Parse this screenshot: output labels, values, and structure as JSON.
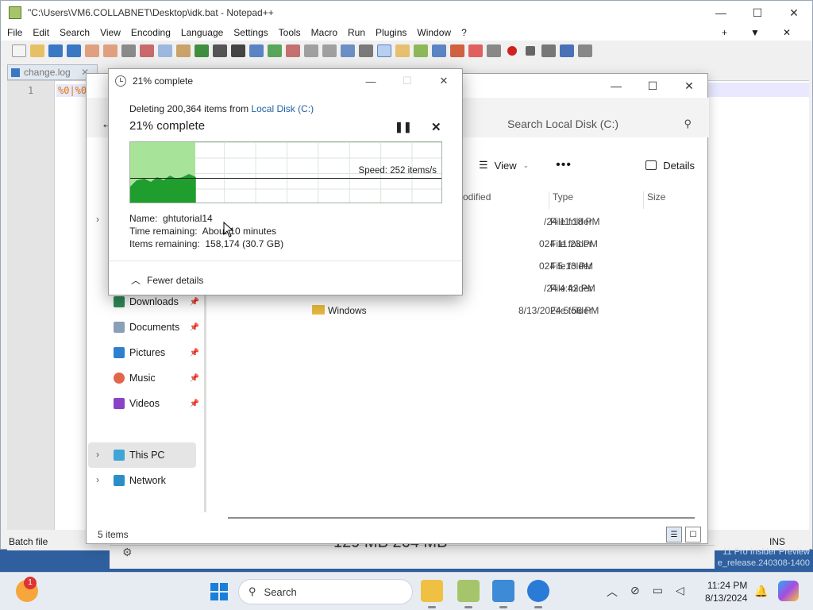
{
  "notepad": {
    "title": "\"C:\\Users\\VM6.COLLABNET\\Desktop\\idk.bat - Notepad++",
    "menu": [
      "File",
      "Edit",
      "Search",
      "View",
      "Encoding",
      "Language",
      "Settings",
      "Tools",
      "Macro",
      "Run",
      "Plugins",
      "Window",
      "?"
    ],
    "menu_right": [
      "+",
      "▼",
      "✕"
    ],
    "tab_label": "change.log",
    "line_number": "1",
    "code": "%0|%0",
    "status_left": "Batch file",
    "status_right": "INS"
  },
  "explorer": {
    "search_placeholder": "Search Local Disk (C:)",
    "view_label": "View",
    "more_label": "•••",
    "details_label": "Details",
    "columns": {
      "modified": "odified",
      "type": "Type",
      "size": "Size"
    },
    "rows": [
      {
        "name": "",
        "modified": "/24 11:18 PM",
        "type": "File folder"
      },
      {
        "name": "",
        "modified": "024 11:23 PM",
        "type": "File folder"
      },
      {
        "name": "",
        "modified": "024 5:13 PM",
        "type": "File folder"
      },
      {
        "name": "",
        "modified": "/24 4:42 PM",
        "type": "File folder"
      },
      {
        "name": "Windows",
        "modified": "8/13/2024 5:56 PM",
        "type": "File folder"
      }
    ],
    "nav": {
      "downloads": "Downloads",
      "documents": "Documents",
      "pictures": "Pictures",
      "music": "Music",
      "videos": "Videos",
      "this_pc": "This PC",
      "network": "Network"
    },
    "status": "5 items"
  },
  "dialog": {
    "title": "21% complete",
    "summary_prefix": "Deleting 200,364 items from ",
    "summary_link": "Local Disk (C:)",
    "percent_text": "21% complete",
    "progress": 0.21,
    "speed": "Speed: 252 items/s",
    "name_label": "Name:",
    "name_value": "ghtutorial14",
    "time_label": "Time remaining:",
    "time_value": "About 10 minutes",
    "items_label": "Items remaining:",
    "items_value": "158,174 (30.7 GB)",
    "fewer_details": "Fewer details"
  },
  "background": {
    "size_text": "129 MB    264 MB",
    "watermark_line1": "11 Pro Insider Preview",
    "watermark_line2": "e_release.240308-1400"
  },
  "taskbar": {
    "notification_count": "1",
    "search_label": "Search",
    "time": "11:24 PM",
    "date": "8/13/2024"
  },
  "colors": {
    "progress_fill": "#a8e39a",
    "graph_series": "#1f9e2e",
    "link": "#1f5fa6",
    "folder": "#e7b93d"
  }
}
